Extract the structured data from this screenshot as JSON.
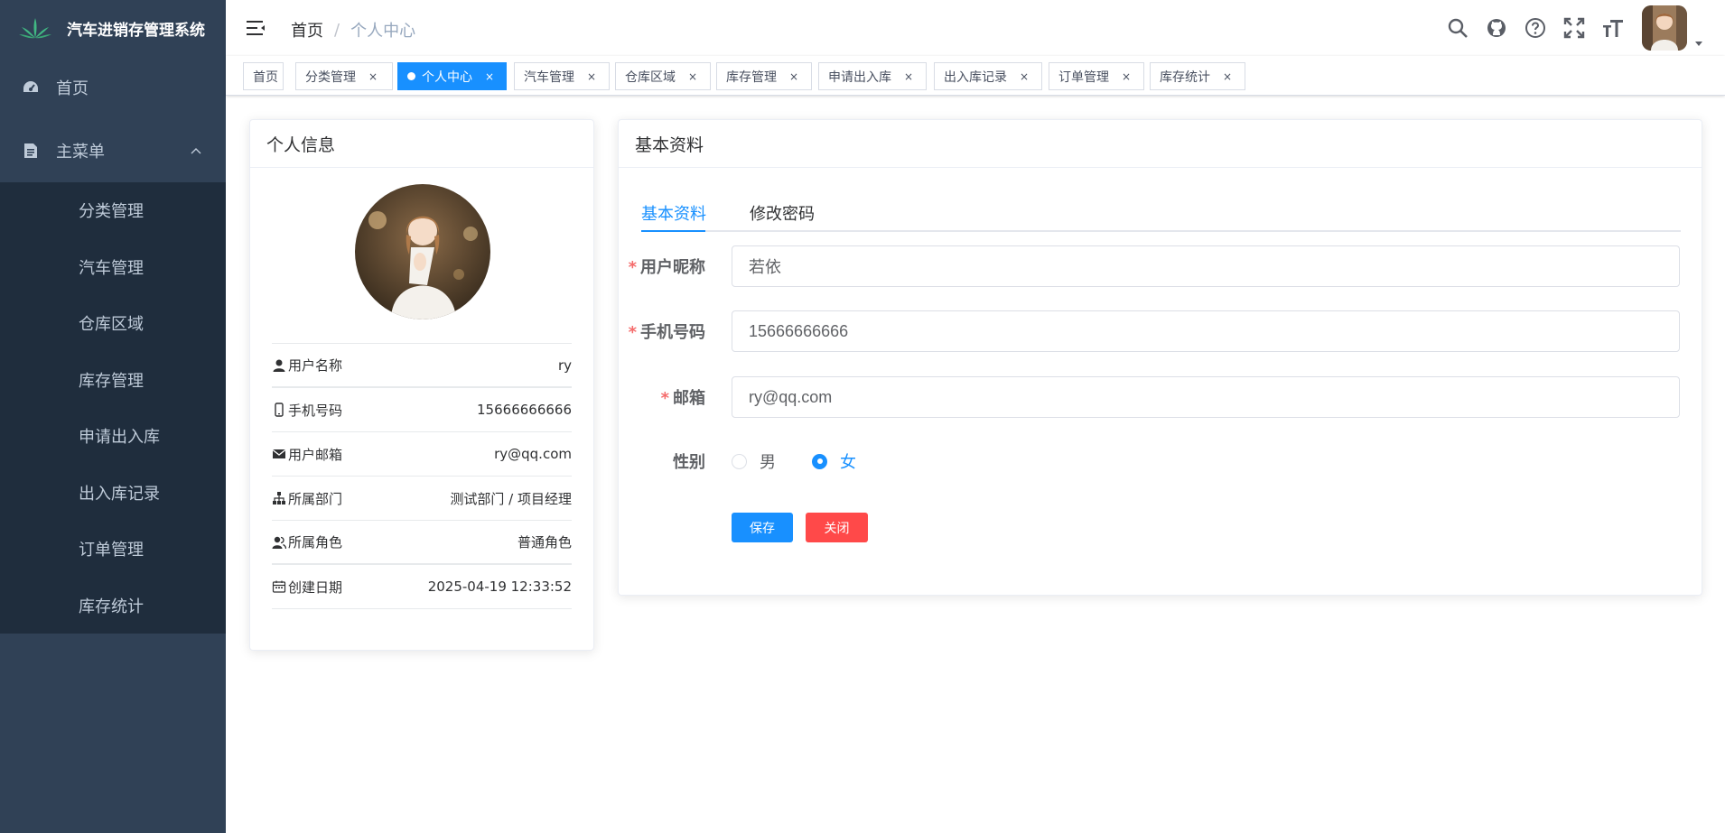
{
  "app": {
    "title": "汽车进销存管理系统"
  },
  "sidebar": {
    "home_label": "首页",
    "main_menu_label": "主菜单",
    "sub_items": [
      "分类管理",
      "汽车管理",
      "仓库区域",
      "库存管理",
      "申请出入库",
      "出入库记录",
      "订单管理",
      "库存统计"
    ]
  },
  "navbar": {
    "breadcrumb": {
      "home": "首页",
      "separator": "/",
      "current": "个人中心"
    },
    "icons": [
      "search-icon",
      "github-icon",
      "question-icon",
      "fullscreen-icon",
      "font-size-icon"
    ]
  },
  "tags": [
    {
      "label": "首页",
      "closable": false,
      "active": false
    },
    {
      "label": "分类管理",
      "closable": true,
      "active": false
    },
    {
      "label": "个人中心",
      "closable": true,
      "active": true
    },
    {
      "label": "汽车管理",
      "closable": true,
      "active": false
    },
    {
      "label": "仓库区域",
      "closable": true,
      "active": false
    },
    {
      "label": "库存管理",
      "closable": true,
      "active": false
    },
    {
      "label": "申请出入库",
      "closable": true,
      "active": false
    },
    {
      "label": "出入库记录",
      "closable": true,
      "active": false
    },
    {
      "label": "订单管理",
      "closable": true,
      "active": false
    },
    {
      "label": "库存统计",
      "closable": true,
      "active": false
    }
  ],
  "tag_close_glyph": "×",
  "profile": {
    "title": "个人信息",
    "rows": [
      {
        "label": "用户名称",
        "value": "ry",
        "icon": "user-icon"
      },
      {
        "label": "手机号码",
        "value": "15666666666",
        "icon": "phone-icon"
      },
      {
        "label": "用户邮箱",
        "value": "ry@qq.com",
        "icon": "email-icon"
      },
      {
        "label": "所属部门",
        "value": "测试部门 / 项目经理",
        "icon": "tree-icon"
      },
      {
        "label": "所属角色",
        "value": "普通角色",
        "icon": "peoples-icon"
      },
      {
        "label": "创建日期",
        "value": "2025-04-19 12:33:52",
        "icon": "date-icon"
      }
    ]
  },
  "basic": {
    "title": "基本资料",
    "tabs": [
      "基本资料",
      "修改密码"
    ],
    "fields": {
      "nickname": {
        "label": "用户昵称",
        "value": "若依",
        "required": true
      },
      "phone": {
        "label": "手机号码",
        "value": "15666666666",
        "required": true
      },
      "email": {
        "label": "邮箱",
        "value": "ry@qq.com",
        "required": true
      },
      "sex": {
        "label": "性别",
        "options": [
          "男",
          "女"
        ],
        "selected": "女"
      }
    },
    "required_mark": "*",
    "save_label": "保存",
    "close_label": "关闭"
  },
  "colors": {
    "primary": "#1890ff",
    "danger": "#ff4949",
    "sidebar_bg": "#304156",
    "submenu_bg": "#1f2d3d"
  }
}
